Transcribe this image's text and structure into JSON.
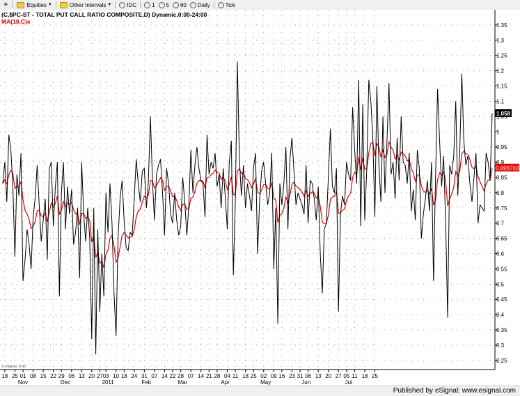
{
  "toolbar": {
    "items": [
      {
        "label": "Equities",
        "icon": "folder-icon",
        "dropdown": true
      },
      {
        "label": "Other Intervals",
        "icon": "folder-icon",
        "dropdown": true
      },
      {
        "label": "IDC",
        "icon": "clock-icon"
      },
      {
        "label": "1",
        "icon": "clock-icon"
      },
      {
        "label": "5",
        "icon": "clock-icon"
      },
      {
        "label": "60",
        "icon": "clock-icon"
      },
      {
        "label": "Daily",
        "icon": "clock-icon"
      },
      {
        "label": "Tick",
        "icon": "clock-icon"
      }
    ]
  },
  "footer": {
    "text": "Published by eSignal: www.esignal.com"
  },
  "chart_data": {
    "type": "line",
    "title": "(C,$PC-ST - TOTAL PUT CALL RATIO COMPOSITE,D) Dynamic,0:00-24:00",
    "subtitle": "MA(10,C)e",
    "watermark": "© eSignal, 2010",
    "ylim": [
      0.22,
      1.4
    ],
    "y_ticks": [
      0.25,
      0.3,
      0.35,
      0.4,
      0.45,
      0.5,
      0.55,
      0.6,
      0.65,
      0.7,
      0.75,
      0.8,
      0.85,
      0.9,
      0.95,
      1,
      1.05,
      1.1,
      1.15,
      1.2,
      1.25,
      1.3,
      1.35
    ],
    "y_tick_labels": [
      "0.25",
      "0.3",
      "0.35",
      "0.4",
      "0.45",
      "0.5",
      "0.55",
      "0.6",
      "0.65",
      "0.7",
      "0.75",
      "0.8",
      "0.85",
      "0.9",
      "0.95",
      "1",
      "1.05",
      "1.1",
      "1.15",
      "1.2",
      "1.25",
      "1.3",
      "1.35"
    ],
    "x_day_labels": [
      {
        "i": 1,
        "label": "18"
      },
      {
        "i": 6,
        "label": "25"
      },
      {
        "i": 10,
        "label": "01"
      },
      {
        "i": 15,
        "label": "08"
      },
      {
        "i": 20,
        "label": "15"
      },
      {
        "i": 25,
        "label": "22"
      },
      {
        "i": 29,
        "label": "29"
      },
      {
        "i": 34,
        "label": "06"
      },
      {
        "i": 39,
        "label": "13"
      },
      {
        "i": 44,
        "label": "20"
      },
      {
        "i": 48,
        "label": "27"
      },
      {
        "i": 51,
        "label": "03"
      },
      {
        "i": 56,
        "label": "10"
      },
      {
        "i": 60,
        "label": "18"
      },
      {
        "i": 65,
        "label": "24"
      },
      {
        "i": 70,
        "label": "31"
      },
      {
        "i": 75,
        "label": "07"
      },
      {
        "i": 80,
        "label": "14"
      },
      {
        "i": 84,
        "label": "22"
      },
      {
        "i": 88,
        "label": "28"
      },
      {
        "i": 93,
        "label": "07"
      },
      {
        "i": 98,
        "label": "14"
      },
      {
        "i": 102,
        "label": "21"
      },
      {
        "i": 106,
        "label": "28"
      },
      {
        "i": 111,
        "label": "04"
      },
      {
        "i": 115,
        "label": "11"
      },
      {
        "i": 120,
        "label": "18"
      },
      {
        "i": 124,
        "label": "25"
      },
      {
        "i": 129,
        "label": "02"
      },
      {
        "i": 134,
        "label": "09"
      },
      {
        "i": 138,
        "label": "16"
      },
      {
        "i": 143,
        "label": "23"
      },
      {
        "i": 147,
        "label": "31"
      },
      {
        "i": 151,
        "label": "06"
      },
      {
        "i": 156,
        "label": "13"
      },
      {
        "i": 161,
        "label": "20"
      },
      {
        "i": 166,
        "label": "27"
      },
      {
        "i": 170,
        "label": "05"
      },
      {
        "i": 174,
        "label": "11"
      },
      {
        "i": 179,
        "label": "18"
      },
      {
        "i": 184,
        "label": "25"
      }
    ],
    "x_month_labels": [
      {
        "i": 10,
        "label": "Nov"
      },
      {
        "i": 31,
        "label": "Dec"
      },
      {
        "i": 52,
        "label": "2011"
      },
      {
        "i": 71,
        "label": "Feb"
      },
      {
        "i": 89,
        "label": "Mar"
      },
      {
        "i": 110,
        "label": "Apr"
      },
      {
        "i": 130,
        "label": "May"
      },
      {
        "i": 150,
        "label": "Jun"
      },
      {
        "i": 171,
        "label": "Jul"
      }
    ],
    "last_value_label": "1.058",
    "ma_value_label": "0.898703",
    "series": [
      {
        "name": "$PC-ST",
        "color": "#000000",
        "values": [
          0.83,
          0.9,
          0.77,
          0.99,
          0.94,
          0.82,
          0.59,
          0.86,
          0.79,
          0.93,
          0.51,
          0.58,
          0.68,
          0.63,
          0.55,
          0.72,
          0.78,
          0.89,
          0.76,
          0.64,
          0.71,
          0.78,
          0.58,
          0.88,
          0.9,
          0.69,
          0.82,
          0.9,
          0.46,
          0.8,
          0.9,
          0.68,
          0.82,
          0.73,
          0.81,
          0.63,
          0.67,
          0.75,
          0.52,
          0.9,
          0.73,
          0.64,
          0.75,
          0.65,
          0.32,
          0.75,
          0.27,
          0.68,
          0.41,
          0.6,
          0.46,
          0.8,
          0.67,
          0.83,
          0.7,
          0.47,
          0.33,
          0.65,
          0.78,
          0.84,
          0.71,
          0.62,
          0.61,
          0.67,
          0.66,
          0.78,
          0.91,
          0.83,
          0.77,
          0.87,
          0.88,
          0.75,
          0.84,
          1.05,
          0.84,
          0.71,
          0.86,
          0.89,
          0.91,
          0.8,
          0.66,
          0.88,
          0.83,
          0.73,
          0.7,
          0.8,
          0.71,
          0.66,
          0.69,
          0.85,
          0.77,
          0.66,
          0.76,
          0.94,
          0.8,
          0.89,
          0.95,
          0.88,
          0.84,
          0.83,
          0.72,
          0.99,
          0.86,
          0.9,
          0.88,
          0.93,
          0.82,
          0.86,
          0.75,
          0.88,
          0.79,
          0.68,
          0.9,
          0.97,
          0.53,
          0.78,
          1.23,
          0.91,
          0.79,
          0.89,
          0.75,
          0.83,
          0.79,
          0.74,
          0.88,
          0.93,
          0.6,
          0.77,
          0.87,
          0.9,
          0.83,
          0.76,
          0.8,
          0.93,
          0.55,
          0.75,
          0.37,
          0.83,
          0.76,
          0.83,
          0.95,
          0.68,
          0.91,
          0.98,
          0.87,
          0.76,
          0.8,
          0.78,
          0.76,
          0.73,
          0.89,
          0.7,
          0.84,
          0.83,
          0.78,
          0.71,
          0.82,
          0.6,
          0.47,
          0.68,
          0.7,
          0.85,
          1.01,
          0.82,
          0.8,
          0.88,
          0.41,
          0.73,
          0.79,
          0.76,
          0.9,
          0.86,
          0.84,
          1.08,
          0.94,
          0.83,
          1.17,
          0.69,
          1.09,
          0.71,
          0.88,
          1.17,
          1.1,
          0.98,
          0.72,
          1.15,
          0.89,
          0.77,
          1.05,
          0.8,
          0.97,
          1.16,
          0.86,
          0.9,
          0.78,
          0.98,
          0.84,
          1.05,
          0.9,
          0.89,
          0.83,
          0.93,
          0.74,
          0.81,
          0.71,
          0.94,
          0.88,
          0.65,
          0.73,
          0.78,
          0.84,
          0.74,
          0.9,
          0.51,
          0.85,
          1.14,
          0.97,
          0.82,
          0.92,
          0.7,
          0.39,
          0.89,
          0.86,
          0.92,
          1.1,
          0.79,
          0.94,
          1.19,
          0.97,
          0.89,
          0.92,
          0.83,
          0.77,
          0.85,
          0.93,
          0.7,
          0.76,
          0.75,
          0.74,
          0.93,
          0.9,
          0.84,
          1.06
        ]
      },
      {
        "name": "MA(10,C)e",
        "color": "#e00000",
        "values": []
      }
    ]
  }
}
